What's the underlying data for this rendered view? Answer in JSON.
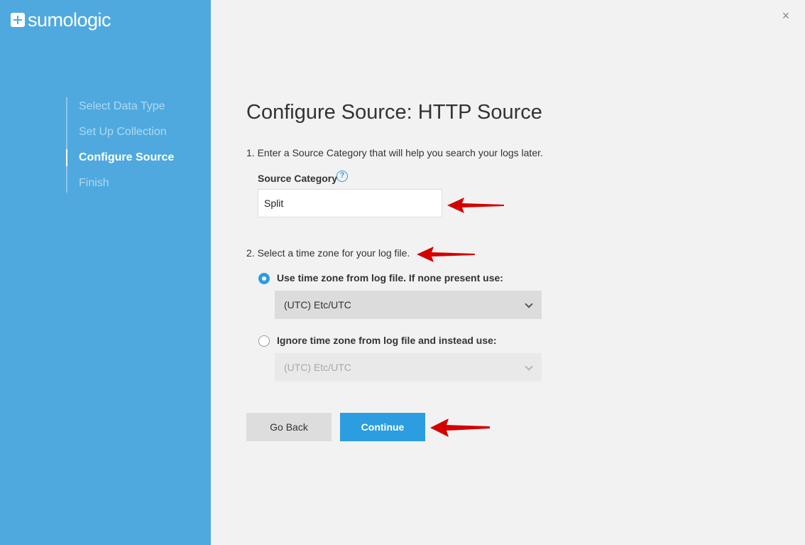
{
  "brand": {
    "logo_text": "sumologic",
    "logo_icon": "plus-square-icon"
  },
  "steps": [
    {
      "label": "Select Data Type",
      "state": "completed"
    },
    {
      "label": "Set Up Collection",
      "state": "completed"
    },
    {
      "label": "Configure Source",
      "state": "active"
    },
    {
      "label": "Finish",
      "state": "upcoming"
    }
  ],
  "close_icon": "×",
  "title": "Configure Source: HTTP Source",
  "section1": {
    "instruction": "1. Enter a Source Category that will help you search your logs later.",
    "field_label": "Source Category",
    "help_icon": "?",
    "value": "Split"
  },
  "section2": {
    "instruction": "2. Select a time zone for your log file.",
    "options": [
      {
        "label": "Use time zone from log file. If none present use:",
        "selected": true,
        "select_value": "(UTC) Etc/UTC"
      },
      {
        "label": "Ignore time zone from log file and instead use:",
        "selected": false,
        "select_value": "(UTC) Etc/UTC"
      }
    ]
  },
  "buttons": {
    "back": "Go Back",
    "continue": "Continue"
  },
  "colors": {
    "sidebar": "#4fa9df",
    "accent": "#2b9de0",
    "annotation_arrow": "#d40000"
  }
}
